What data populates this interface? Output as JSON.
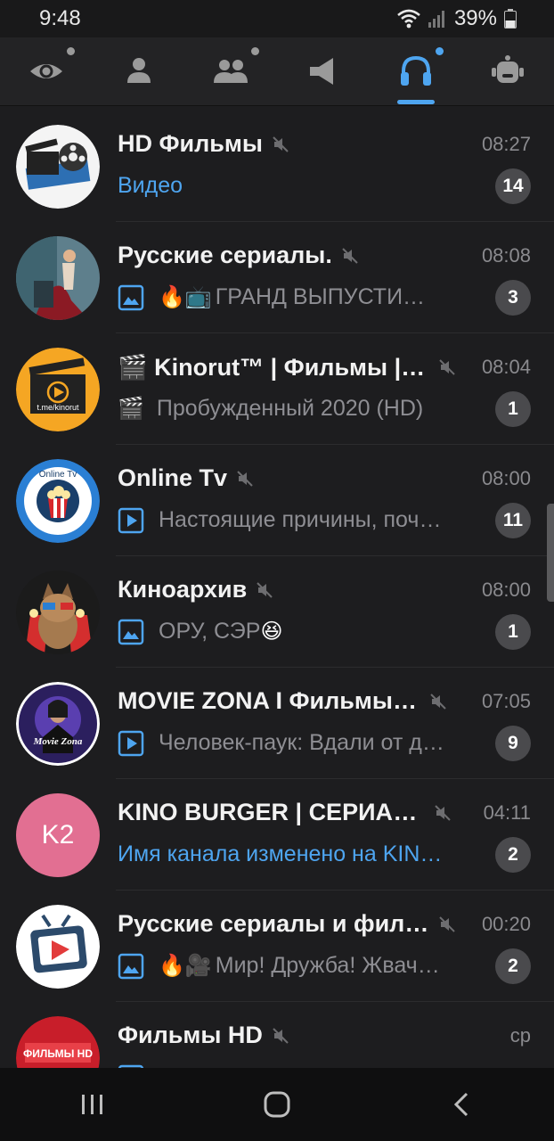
{
  "status": {
    "time": "9:48",
    "battery": "39%"
  },
  "tabs": [
    {
      "icon": "eye-icon",
      "has_dot": true,
      "active": false
    },
    {
      "icon": "user-icon",
      "has_dot": false,
      "active": false
    },
    {
      "icon": "group-icon",
      "has_dot": true,
      "active": false
    },
    {
      "icon": "megaphone-icon",
      "has_dot": false,
      "active": false
    },
    {
      "icon": "headphones-icon",
      "has_dot": true,
      "active": true
    },
    {
      "icon": "robot-icon",
      "has_dot": false,
      "active": false
    }
  ],
  "chats": [
    {
      "title": "HD Фильмы",
      "time": "08:27",
      "preview": "Видео",
      "preview_accent": true,
      "media": "none",
      "emoji": "",
      "badge": "14",
      "avatar": "film-reel-avatar"
    },
    {
      "title": "Русские сериалы.",
      "time": "08:08",
      "preview": "ГРАНД ВЫПУСТИЛИ НОВЫЕ СЕРИИ",
      "preview_accent": false,
      "media": "photo",
      "emoji": "🔥📺",
      "badge": "3",
      "avatar": "woman-chair-avatar"
    },
    {
      "title": "🎬 Kinorut™ | Фильмы | Сериалы",
      "time": "08:04",
      "preview": "Пробужденный 2020 (HD)",
      "preview_accent": false,
      "media": "none",
      "emoji": "🎬",
      "badge": "1",
      "avatar": "clapperboard-avatar",
      "avatar_text": "t.me/kinorut"
    },
    {
      "title": "Online Tv",
      "time": "08:00",
      "preview": "Настоящие причины, почему",
      "preview_accent": false,
      "media": "video",
      "emoji": "",
      "badge": "11",
      "avatar": "popcorn-tv-avatar",
      "avatar_text": "Online Tv"
    },
    {
      "title": "Киноархив",
      "time": "08:00",
      "preview": "ОРУ, СЭР",
      "preview_accent": false,
      "media": "photo",
      "emoji": "",
      "suffix_emoji": "😆",
      "badge": "1",
      "avatar": "cat-popcorn-avatar"
    },
    {
      "title": "MOVIE ZONA I Фильмы и сериалы",
      "time": "07:05",
      "preview": "Человек-паук: Вдали от дома",
      "preview_accent": false,
      "media": "video",
      "emoji": "",
      "badge": "9",
      "avatar": "movie-zona-avatar",
      "avatar_text": "Movie Zona"
    },
    {
      "title": "KINO BURGER | СЕРИАЛЫ",
      "time": "04:11",
      "preview": "Имя канала изменено на KINO BURGER",
      "preview_accent": true,
      "media": "none",
      "emoji": "",
      "badge": "2",
      "avatar": "initials-avatar",
      "initials": "K2"
    },
    {
      "title": "Русские сериалы и фильмы",
      "time": "00:20",
      "preview": "Мир! Дружба! Жвачка!",
      "preview_accent": false,
      "media": "photo",
      "emoji": "🔥🎥",
      "badge": "2",
      "avatar": "tv-play-avatar"
    },
    {
      "title": "Фильмы HD",
      "time": "ср",
      "preview": "",
      "preview_accent": false,
      "media": "photo",
      "emoji": "",
      "badge": "",
      "avatar": "filmy-hd-avatar",
      "avatar_text": "ФИЛЬМЫ HD"
    }
  ],
  "colors": {
    "accent": "#4ea5f0",
    "background": "#1d1d1f",
    "badge": "#4a4a4d",
    "muted_text": "#8e8e93"
  }
}
